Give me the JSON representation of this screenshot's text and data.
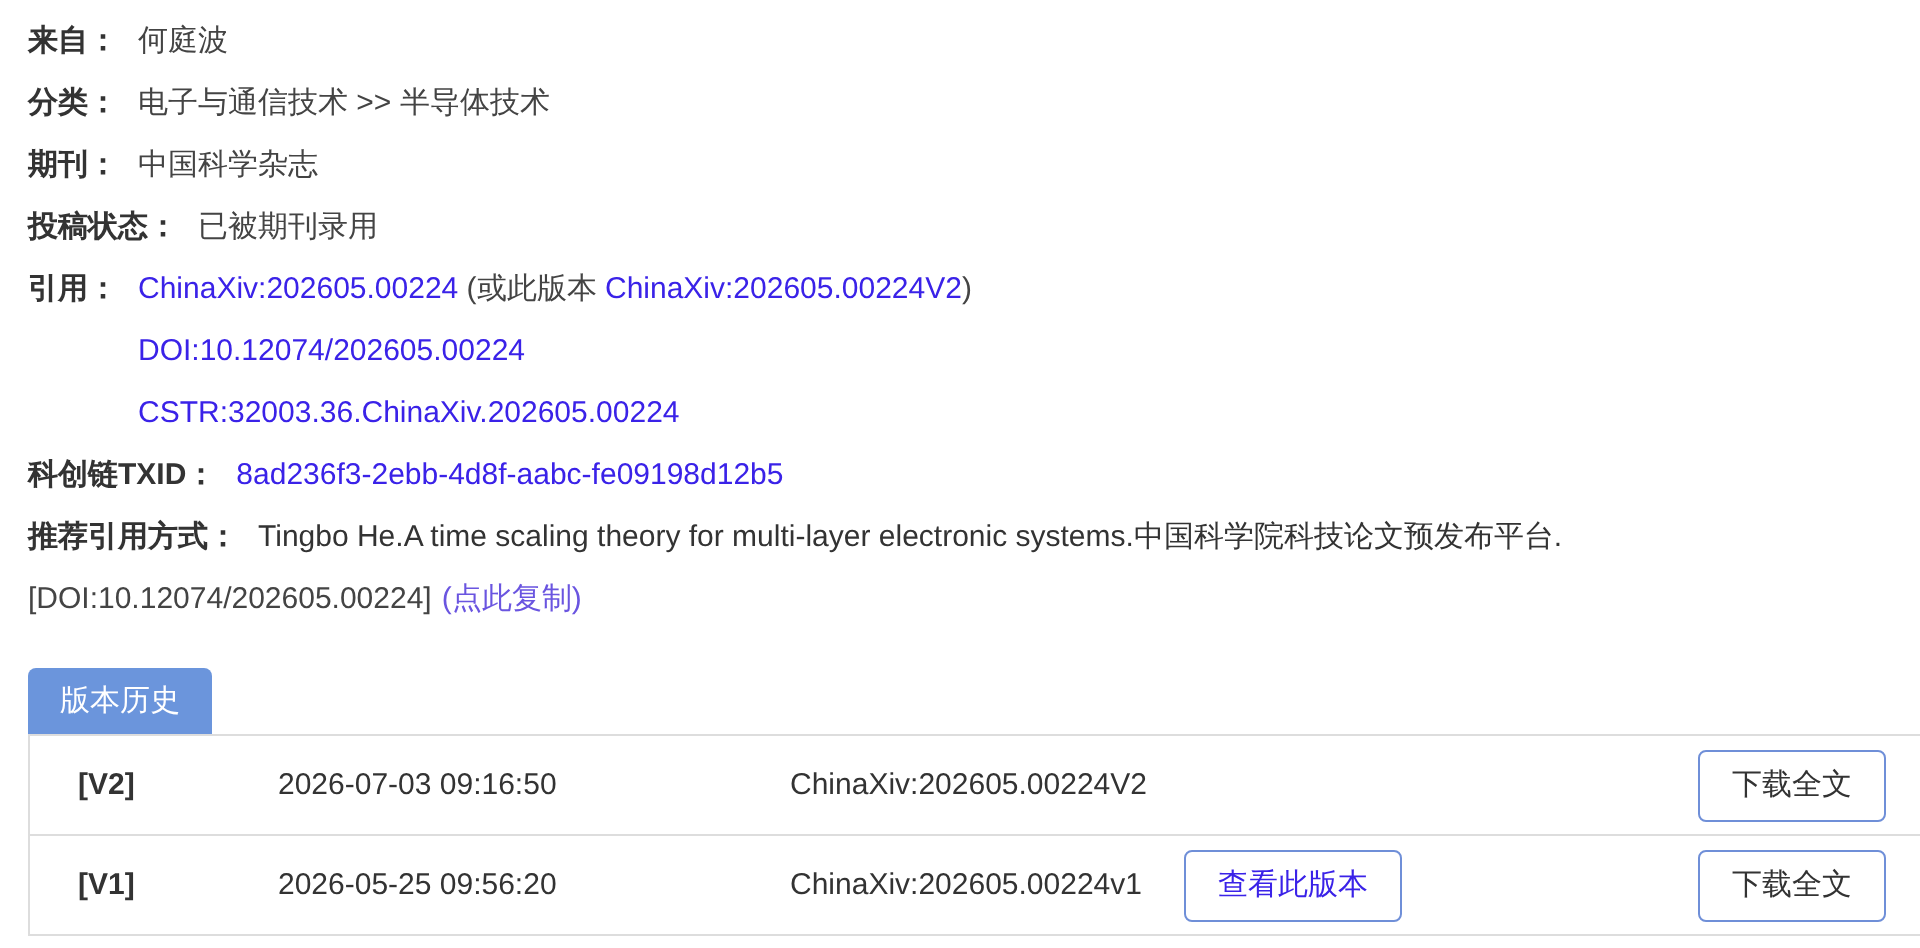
{
  "fields": [
    {
      "kind": "text",
      "label": "来自：",
      "value": "何庭波"
    },
    {
      "kind": "text",
      "label": "分类：",
      "value": "电子与通信技术 >> 半导体技术"
    },
    {
      "kind": "text",
      "label": "期刊：",
      "value": "中国科学杂志"
    },
    {
      "kind": "text",
      "label": "投稿状态：",
      "value": "已被期刊录用"
    },
    {
      "kind": "citation",
      "label": "引用：",
      "lines": [
        [
          {
            "text": "ChinaXiv:202605.00224",
            "link": true
          },
          {
            "text": " (或此版本 ",
            "link": false
          },
          {
            "text": "ChinaXiv:202605.00224V2",
            "link": true
          },
          {
            "text": ")",
            "link": false
          }
        ],
        [
          {
            "text": "DOI:10.12074/202605.00224",
            "link": true
          }
        ],
        [
          {
            "text": "CSTR:32003.36.ChinaXiv.202605.00224",
            "link": true
          }
        ]
      ]
    },
    {
      "kind": "link",
      "label": "科创链TXID：",
      "value": "8ad236f3-2ebb-4d8f-aabc-fe09198d12b5"
    },
    {
      "kind": "recommend",
      "label": "推荐引用方式：",
      "value": "Tingbo He.A time scaling theory for multi-layer electronic systems.中国科学院科技论文预发布平台.",
      "second_line": "[DOI:10.12074/202605.00224]",
      "copy_link": "(点此复制)"
    }
  ],
  "history": {
    "tab": "版本历史",
    "rows": [
      {
        "version": "[V2]",
        "date": "2026-07-03 09:16:50",
        "id": "ChinaXiv:202605.00224V2",
        "download": "下载全文"
      },
      {
        "version": "[V1]",
        "date": "2026-05-25 09:56:20",
        "id": "ChinaXiv:202605.00224v1",
        "view": "查看此版本",
        "download": "下载全文"
      }
    ]
  }
}
